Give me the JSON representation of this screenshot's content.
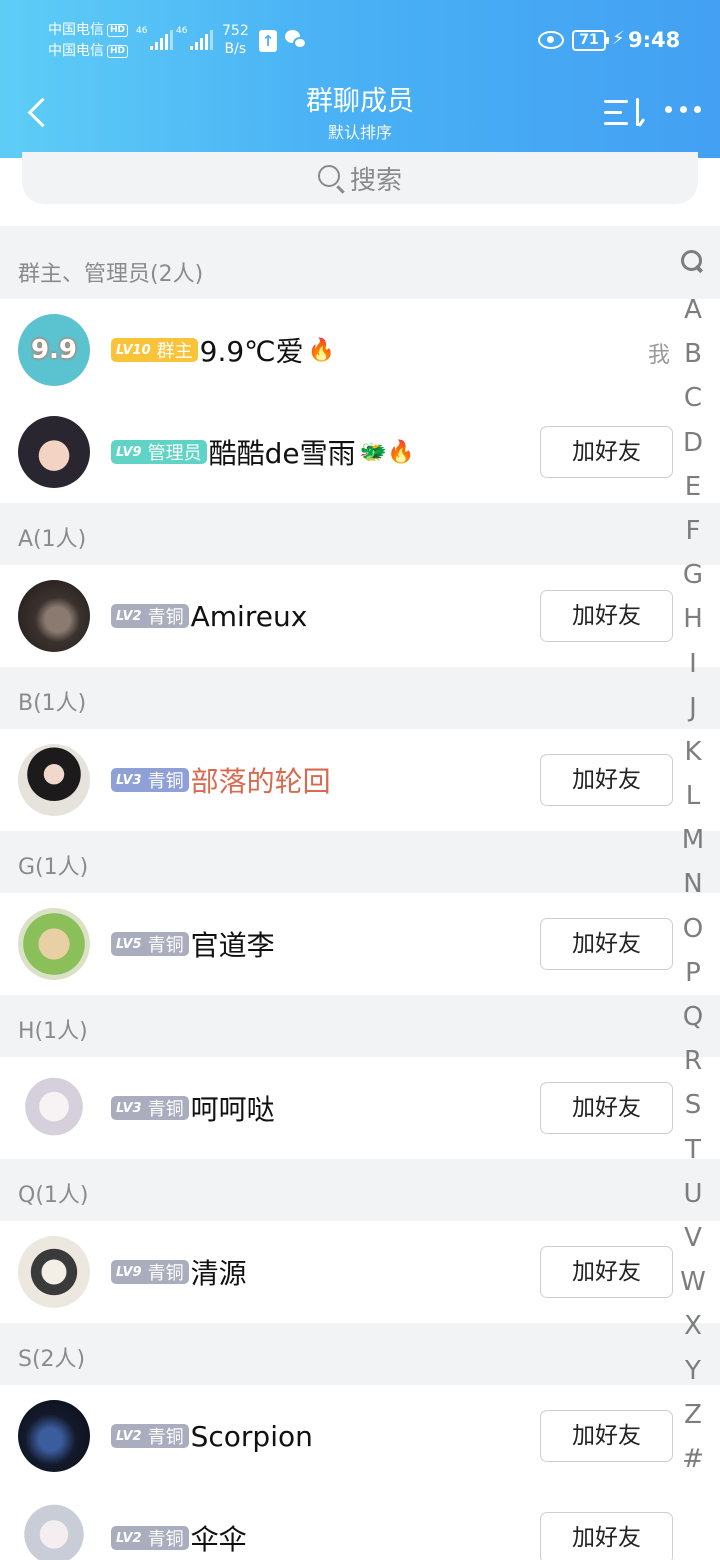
{
  "status_bar": {
    "carrier1": "中国电信",
    "carrier2": "中国电信",
    "hd": "HD",
    "net": "46",
    "speed_value": "752",
    "speed_unit": "B/s",
    "battery": "71",
    "time": "9:48"
  },
  "header": {
    "title": "群聊成员",
    "subtitle": "默认排序"
  },
  "search": {
    "placeholder": "搜索"
  },
  "sections": [
    {
      "header": "群主、管理员(2人)",
      "members": [
        {
          "level": "LV10",
          "role": "群主",
          "name": "9.9℃爱",
          "emoji": "🔥",
          "tag": "我"
        },
        {
          "level": "LV9",
          "role": "管理员",
          "name": "酷酷de雪雨",
          "emoji": "🐲🔥",
          "button": "加好友"
        }
      ]
    },
    {
      "header": "A(1人)",
      "members": [
        {
          "level": "LV2",
          "role": "青铜",
          "name": "Amireux",
          "button": "加好友"
        }
      ]
    },
    {
      "header": "B(1人)",
      "members": [
        {
          "level": "LV3",
          "role": "青铜",
          "name": "部落的轮回",
          "button": "加好友"
        }
      ]
    },
    {
      "header": "G(1人)",
      "members": [
        {
          "level": "LV5",
          "role": "青铜",
          "name": "官道李",
          "button": "加好友"
        }
      ]
    },
    {
      "header": "H(1人)",
      "members": [
        {
          "level": "LV3",
          "role": "青铜",
          "name": "呵呵哒",
          "button": "加好友"
        }
      ]
    },
    {
      "header": "Q(1人)",
      "members": [
        {
          "level": "LV9",
          "role": "青铜",
          "name": "清源",
          "button": "加好友"
        }
      ]
    },
    {
      "header": "S(2人)",
      "members": [
        {
          "level": "LV2",
          "role": "青铜",
          "name": "Scorpion",
          "button": "加好友"
        },
        {
          "level": "LV2",
          "role": "青铜",
          "name": "伞伞",
          "button": "加好友"
        }
      ]
    }
  ],
  "avatar_text": "9.9",
  "index_letters": [
    "A",
    "B",
    "C",
    "D",
    "E",
    "F",
    "G",
    "H",
    "I",
    "J",
    "K",
    "L",
    "M",
    "N",
    "O",
    "P",
    "Q",
    "R",
    "S",
    "T",
    "U",
    "V",
    "W",
    "X",
    "Y",
    "Z",
    "#"
  ],
  "colors": {
    "header_start": "#5ecdf6",
    "header_end": "#43a0f3",
    "lv_gold": "#f9c43a",
    "lv_admin": "#5ed3c6",
    "lv_bronze": "#a9adbd",
    "red_name": "#d96a4f"
  }
}
